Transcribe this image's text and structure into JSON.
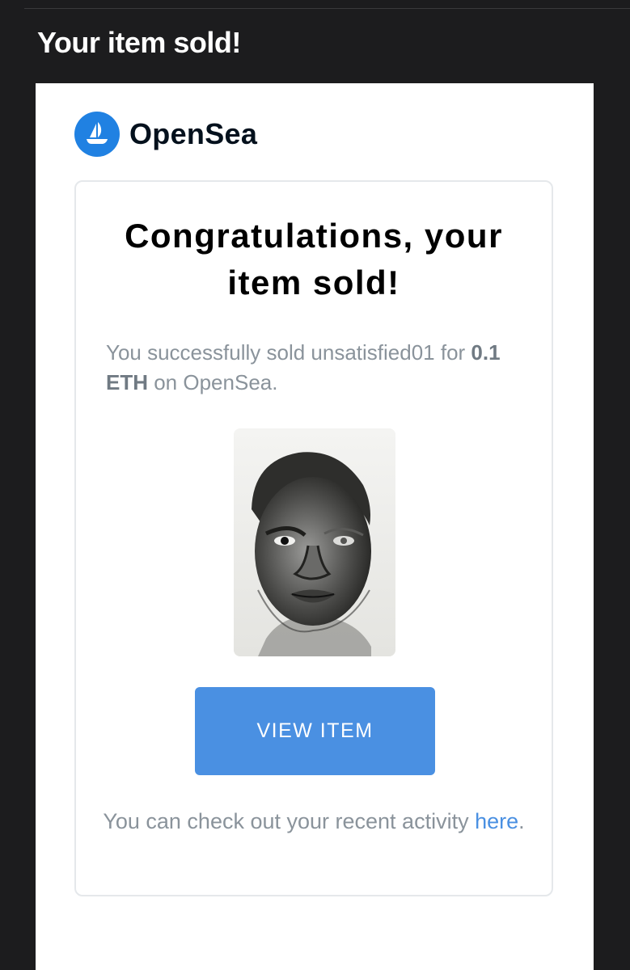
{
  "email": {
    "subject": "Your item sold!"
  },
  "brand": {
    "name": "OpenSea",
    "logo_icon": "sailboat-icon",
    "color": "#2081e2"
  },
  "card": {
    "headline": "Congratulations, your item sold!",
    "message_prefix": "You successfully sold unsatisfied01 for ",
    "price": "0.1 ETH",
    "message_suffix": " on OpenSea.",
    "item_image": "pencil-portrait-drawing",
    "button_label": "VIEW ITEM",
    "button_color": "#4a90e2",
    "footer_prefix": "You can check out your recent activity ",
    "footer_link": "here",
    "footer_suffix": "."
  }
}
